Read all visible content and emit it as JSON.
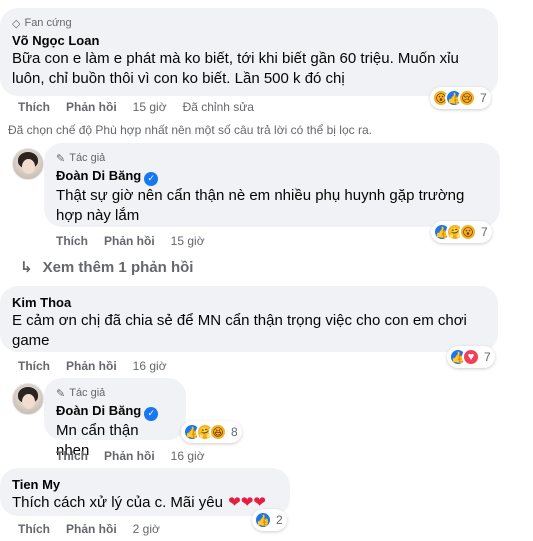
{
  "comment1": {
    "badge": "Fan cứng",
    "badge_icon": "diamond-icon",
    "name": "Võ Ngọc Loan",
    "text": "Bữa con e làm e phát mà ko biết, tới khi biết gần 60 triệu. Muốn xỉu luôn, chỉ buồn thôi vì con ko biết. Lần 500 k đó chị",
    "like": "Thích",
    "reply": "Phản hồi",
    "time": "15 giờ",
    "edited": "Đã chỉnh sửa",
    "reaction_icons": [
      "wow",
      "like",
      "sad"
    ],
    "reaction_count": "7"
  },
  "filter_note": "Đã chọn chế độ Phù hợp nhất nên một số câu trả lời có thể bị lọc ra.",
  "reply1": {
    "badge": "Tác giả",
    "badge_icon": "pen-icon",
    "name": "Đoàn Di Băng",
    "text": "Thật sự giờ nên cẩn thận nè em nhiều phụ huynh gặp trường hợp này lắm",
    "like": "Thích",
    "reply": "Phản hồi",
    "time": "15 giờ",
    "reaction_icons": [
      "like",
      "care",
      "wow"
    ],
    "reaction_count": "7"
  },
  "see_more": "Xem thêm 1 phản hồi",
  "comment2": {
    "name": "Kim Thoa",
    "text": "E cảm ơn chị đã chia sẻ để MN cẩn thận trọng việc cho con em chơi game",
    "like": "Thích",
    "reply": "Phản hồi",
    "time": "16 giờ",
    "reaction_icons": [
      "like",
      "love"
    ],
    "reaction_count": "7"
  },
  "reply2": {
    "badge": "Tác giả",
    "badge_icon": "pen-icon",
    "name": "Đoàn Di Băng",
    "text": "Mn cẩn thận nhen",
    "like": "Thích",
    "reply": "Phản hồi",
    "time": "16 giờ",
    "reaction_icons": [
      "like",
      "care",
      "haha"
    ],
    "reaction_count": "8"
  },
  "comment3": {
    "name": "Tien My",
    "text": "Thích cách xử lý của c. Mãi yêu",
    "hearts": "❤❤❤",
    "like": "Thích",
    "reply": "Phản hồi",
    "time": "2 giờ",
    "reaction_icons": [
      "like"
    ],
    "reaction_count": "2"
  },
  "colors": {
    "bubble": "#f0f2f5",
    "secondary_text": "#65676b",
    "like_blue": "#1877f2",
    "heart_red": "#e41e3f"
  }
}
